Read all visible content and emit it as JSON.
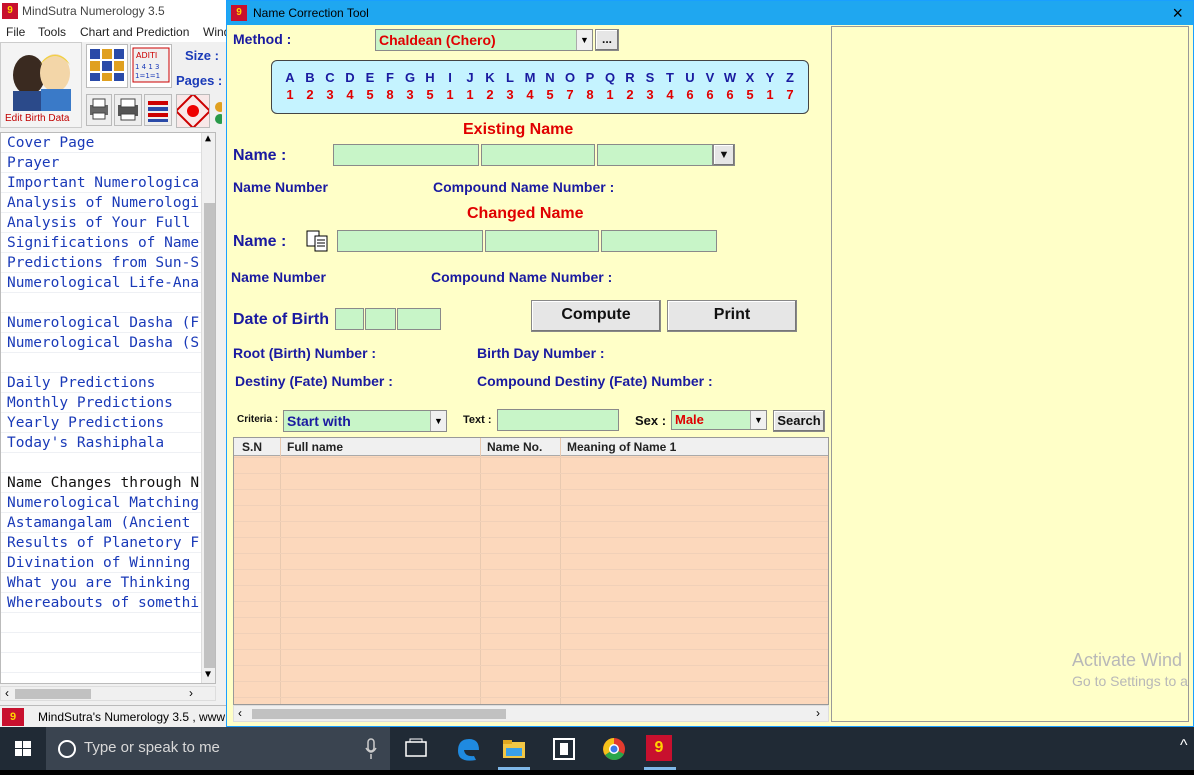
{
  "app": {
    "title": "MindSutra Numerology 3.5",
    "logo": "9",
    "menu": [
      "File",
      "Tools",
      "Chart and Prediction",
      "Wind"
    ],
    "edit_birth_label": "Edit Birth Data",
    "size_label": "Size :",
    "pages_label": "Pages :",
    "status_text": "MindSutra's Numerology 3.5 , www",
    "nav_items": [
      "Cover Page",
      "Prayer",
      "Important Numerologica",
      "Analysis of Numerologi",
      "Analysis of Your Full",
      "Significations of Name",
      "Predictions from Sun-S",
      "Numerological Life-Ana",
      "",
      "Numerological Dasha (F",
      "Numerological Dasha (S",
      "",
      "Daily Predictions",
      "Monthly Predictions",
      "Yearly Predictions",
      "Today's Rashiphala",
      "",
      "Name Changes through N",
      "Numerological Matching",
      "Astamangalam (Ancient",
      "Results of Planetory F",
      "Divination of Winning",
      "What you are Thinking",
      "Whereabouts of somethi"
    ],
    "nav_active_index": 17
  },
  "tool": {
    "title": "Name Correction Tool",
    "logo": "9",
    "close_icon": "×",
    "method_label": "Method :",
    "method_value": "Chaldean (Chero)",
    "method_more": "...",
    "alphabet": {
      "letters": [
        "A",
        "B",
        "C",
        "D",
        "E",
        "F",
        "G",
        "H",
        "I",
        "J",
        "K",
        "L",
        "M",
        "N",
        "O",
        "P",
        "Q",
        "R",
        "S",
        "T",
        "U",
        "V",
        "W",
        "X",
        "Y",
        "Z"
      ],
      "numbers": [
        "1",
        "2",
        "3",
        "4",
        "5",
        "8",
        "3",
        "5",
        "1",
        "1",
        "2",
        "3",
        "4",
        "5",
        "7",
        "8",
        "1",
        "2",
        "3",
        "4",
        "6",
        "6",
        "6",
        "5",
        "1",
        "7"
      ]
    },
    "existing_heading": "Existing Name",
    "changed_heading": "Changed Name",
    "name_label": "Name :",
    "name_number_label": "Name Number",
    "compound_name_number_label": "Compound Name Number :",
    "dob_label": "Date of Birth",
    "compute_label": "Compute",
    "print_label": "Print",
    "root_label": "Root (Birth) Number :",
    "birth_day_label": "Birth Day Number :",
    "destiny_label": "Destiny (Fate) Number :",
    "compound_destiny_label": "Compound Destiny (Fate) Number :",
    "criteria_label": "Criteria :",
    "criteria_value": "Start with",
    "text_label": "Text :",
    "sex_label": "Sex :",
    "sex_value": "Male",
    "search_label": "Search",
    "grid_columns": [
      "S.N",
      "Full name",
      "Name No.",
      "Meaning of Name 1"
    ]
  },
  "taskbar": {
    "search_placeholder": "Type or speak to me"
  },
  "watermark": {
    "line1": "Activate Wind",
    "line2": "Go to Settings to a"
  },
  "colors": {
    "tool_bg": "#ffffc8",
    "field_bg": "#c8f5c8",
    "alpha_bg": "#c5f3ff",
    "grid_bg": "#fcd8bc",
    "label_blue": "#1a1aa0",
    "label_red": "#e00000",
    "titlebar_blue": "#1fa7f0"
  }
}
